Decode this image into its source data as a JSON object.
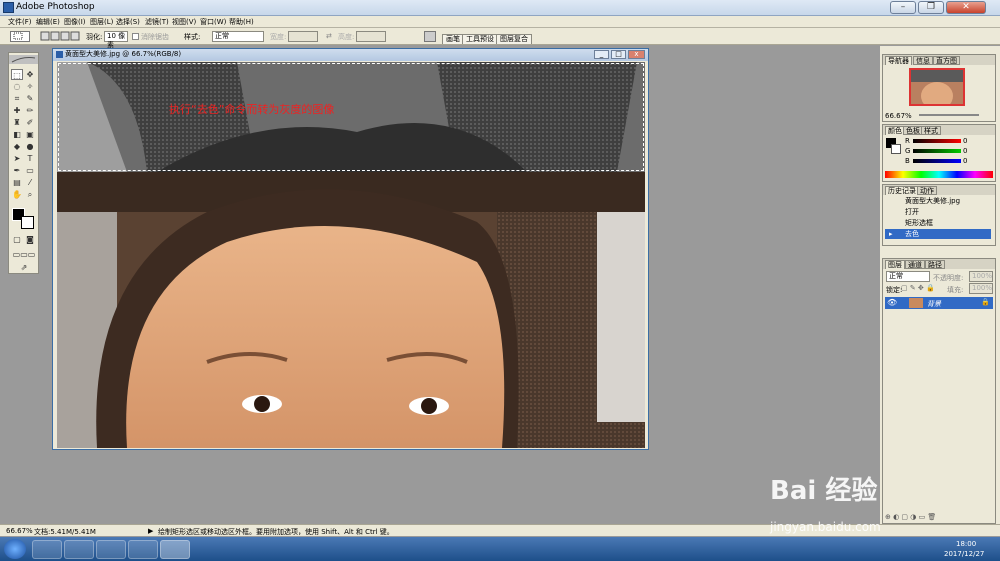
{
  "window": {
    "title": "Adobe Photoshop",
    "min_label": "–",
    "max_label": "❐",
    "close_label": "✕"
  },
  "menu": [
    "文件(F)",
    "编辑(E)",
    "图像(I)",
    "图层(L)",
    "选择(S)",
    "滤镜(T)",
    "视图(V)",
    "窗口(W)",
    "帮助(H)"
  ],
  "options": {
    "feather_label": "羽化:",
    "feather_value": "10 像素",
    "antialias_label": "消除锯齿",
    "style_label": "样式:",
    "style_value": "正常",
    "width_label": "宽度:",
    "height_label": "高度:",
    "tabs": [
      "画笔",
      "工具预设",
      "图层复合"
    ]
  },
  "document": {
    "title": "黄面型大美修.jpg @ 66.7%(RGB/8)",
    "overlay_text": "执行“去色”命令而转为灰度的图像"
  },
  "navigator": {
    "tabs": [
      "导航器",
      "信息",
      "直方图"
    ],
    "zoom": "66.67%"
  },
  "color": {
    "tabs": [
      "颜色",
      "色板",
      "样式"
    ],
    "channels": [
      {
        "name": "R",
        "value": "0"
      },
      {
        "name": "G",
        "value": "0"
      },
      {
        "name": "B",
        "value": "0"
      }
    ]
  },
  "history": {
    "tabs": [
      "历史记录",
      "动作"
    ],
    "snapshot": "黄面型大美修.jpg",
    "items": [
      "打开",
      "矩形选框",
      "去色"
    ],
    "selected_index": 2
  },
  "layers": {
    "tabs": [
      "图层",
      "通道",
      "路径"
    ],
    "blend_mode": "正常",
    "opacity_label": "不透明度:",
    "opacity": "100%",
    "lock_label": "锁定:",
    "fill_label": "填充:",
    "fill": "100%",
    "layer_name": "背景"
  },
  "status": {
    "zoom": "66.67%",
    "doc_size": "文档:5.41M/5.41M",
    "hint": "绘制矩形选区或移动选区外框。要用附加选项，使用 Shift、Alt 和 Ctrl 键。"
  },
  "taskbar": {
    "time": "18:00",
    "date": "2017/12/27"
  },
  "watermark": {
    "brand": "Bai 经验",
    "url": "jingyan.baidu.com"
  }
}
